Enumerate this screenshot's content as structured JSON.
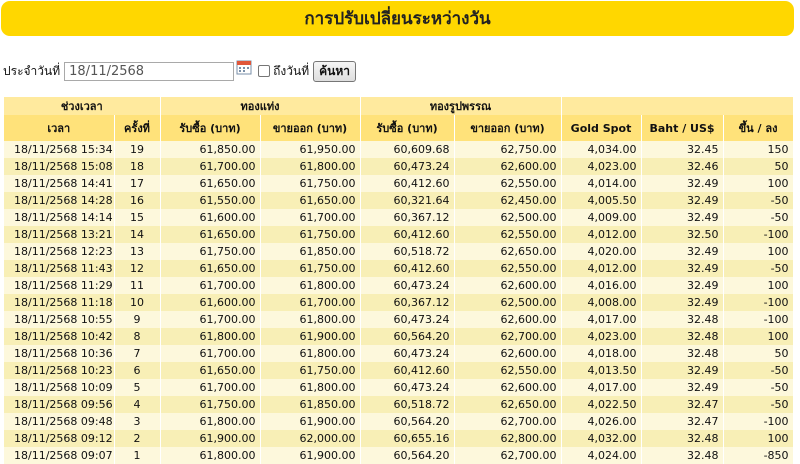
{
  "header": {
    "title": "การปรับเปลี่ยนระหว่างวัน"
  },
  "filter": {
    "date_label": "ประจำวันที่",
    "date_value": "18/11/2568",
    "to_date_label": "ถึงวันที่",
    "search_label": "ค้นหา",
    "calendar_icon": "calendar-icon"
  },
  "table": {
    "group_headers": {
      "time": "ช่วงเวลา",
      "gold_bar": "ทองแท่ง",
      "gold_ornament": "ทองรูปพรรณ"
    },
    "columns": {
      "time": "เวลา",
      "round": "ครั้งที่",
      "bar_buy": "รับซื้อ (บาท)",
      "bar_sell": "ขายออก (บาท)",
      "orn_buy": "รับซื้อ (บาท)",
      "orn_sell": "ขายออก (บาท)",
      "gold_spot": "Gold Spot",
      "baht_usd": "Baht / US$",
      "change": "ขึ้น / ลง"
    },
    "rows": [
      [
        "18/11/2568 15:34",
        "19",
        "61,850.00",
        "61,950.00",
        "60,609.68",
        "62,750.00",
        "4,034.00",
        "32.45",
        "150"
      ],
      [
        "18/11/2568 15:08",
        "18",
        "61,700.00",
        "61,800.00",
        "60,473.24",
        "62,600.00",
        "4,023.00",
        "32.46",
        "50"
      ],
      [
        "18/11/2568 14:41",
        "17",
        "61,650.00",
        "61,750.00",
        "60,412.60",
        "62,550.00",
        "4,014.00",
        "32.49",
        "100"
      ],
      [
        "18/11/2568 14:28",
        "16",
        "61,550.00",
        "61,650.00",
        "60,321.64",
        "62,450.00",
        "4,005.50",
        "32.49",
        "-50"
      ],
      [
        "18/11/2568 14:14",
        "15",
        "61,600.00",
        "61,700.00",
        "60,367.12",
        "62,500.00",
        "4,009.00",
        "32.49",
        "-50"
      ],
      [
        "18/11/2568 13:21",
        "14",
        "61,650.00",
        "61,750.00",
        "60,412.60",
        "62,550.00",
        "4,012.00",
        "32.50",
        "-100"
      ],
      [
        "18/11/2568 12:23",
        "13",
        "61,750.00",
        "61,850.00",
        "60,518.72",
        "62,650.00",
        "4,020.00",
        "32.49",
        "100"
      ],
      [
        "18/11/2568 11:43",
        "12",
        "61,650.00",
        "61,750.00",
        "60,412.60",
        "62,550.00",
        "4,012.00",
        "32.49",
        "-50"
      ],
      [
        "18/11/2568 11:29",
        "11",
        "61,700.00",
        "61,800.00",
        "60,473.24",
        "62,600.00",
        "4,016.00",
        "32.49",
        "100"
      ],
      [
        "18/11/2568 11:18",
        "10",
        "61,600.00",
        "61,700.00",
        "60,367.12",
        "62,500.00",
        "4,008.00",
        "32.49",
        "-100"
      ],
      [
        "18/11/2568 10:55",
        "9",
        "61,700.00",
        "61,800.00",
        "60,473.24",
        "62,600.00",
        "4,017.00",
        "32.48",
        "-100"
      ],
      [
        "18/11/2568 10:42",
        "8",
        "61,800.00",
        "61,900.00",
        "60,564.20",
        "62,700.00",
        "4,023.00",
        "32.48",
        "100"
      ],
      [
        "18/11/2568 10:36",
        "7",
        "61,700.00",
        "61,800.00",
        "60,473.24",
        "62,600.00",
        "4,018.00",
        "32.48",
        "50"
      ],
      [
        "18/11/2568 10:23",
        "6",
        "61,650.00",
        "61,750.00",
        "60,412.60",
        "62,550.00",
        "4,013.50",
        "32.49",
        "-50"
      ],
      [
        "18/11/2568 10:09",
        "5",
        "61,700.00",
        "61,800.00",
        "60,473.24",
        "62,600.00",
        "4,017.00",
        "32.49",
        "-50"
      ],
      [
        "18/11/2568 09:56",
        "4",
        "61,750.00",
        "61,850.00",
        "60,518.72",
        "62,650.00",
        "4,022.50",
        "32.47",
        "-50"
      ],
      [
        "18/11/2568 09:48",
        "3",
        "61,800.00",
        "61,900.00",
        "60,564.20",
        "62,700.00",
        "4,026.00",
        "32.47",
        "-100"
      ],
      [
        "18/11/2568 09:12",
        "2",
        "61,900.00",
        "62,000.00",
        "60,655.16",
        "62,800.00",
        "4,032.00",
        "32.48",
        "100"
      ],
      [
        "18/11/2568 09:07",
        "1",
        "61,800.00",
        "61,900.00",
        "60,564.20",
        "62,700.00",
        "4,024.00",
        "32.48",
        "-850"
      ]
    ]
  },
  "colors": {
    "banner": "#ffd700",
    "header_cell": "#ffe68c",
    "row_odd": "#fdf8dc",
    "row_even": "#f8efb6"
  }
}
